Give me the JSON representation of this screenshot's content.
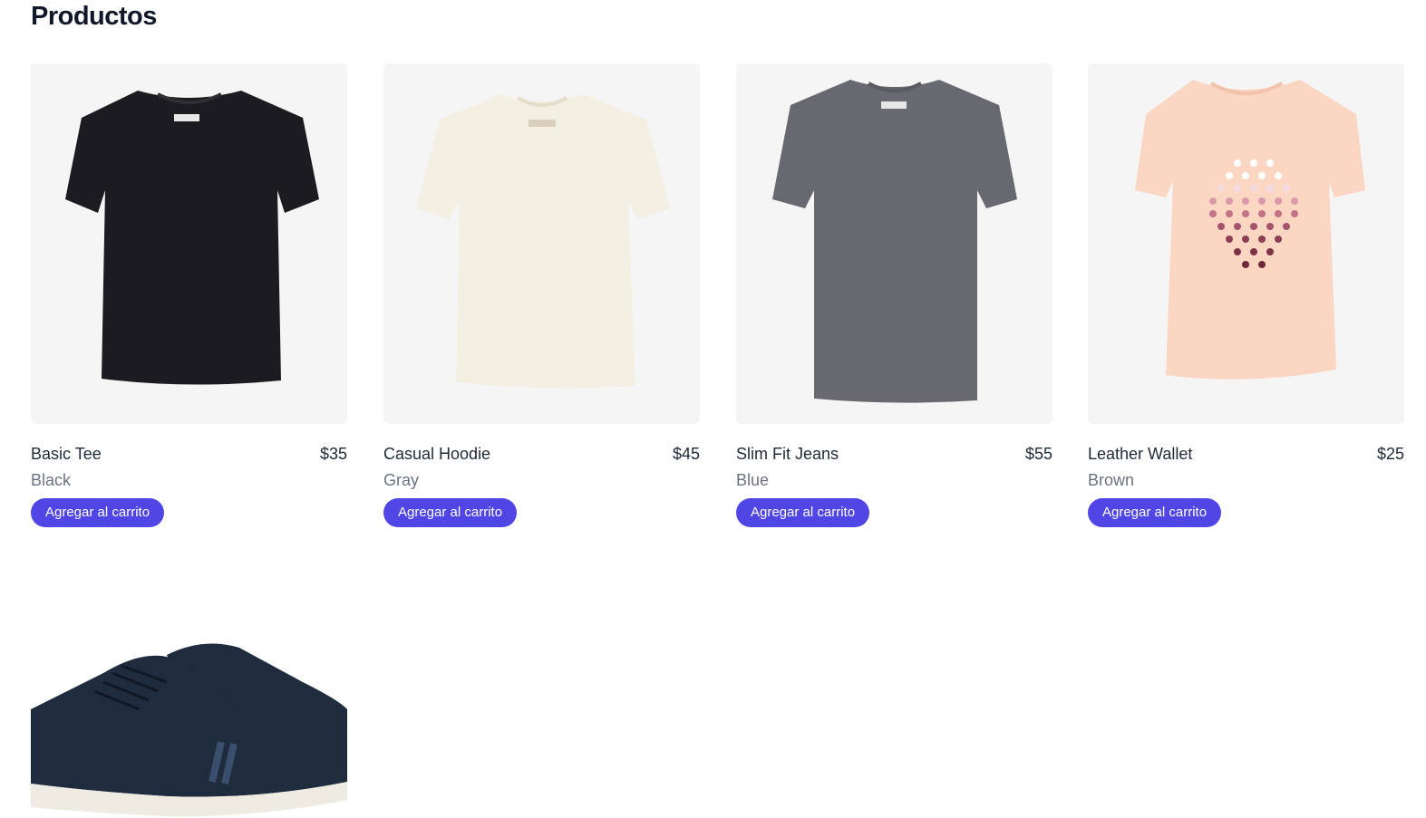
{
  "page": {
    "title": "Productos"
  },
  "colors": {
    "accent": "#4f46e5",
    "card_bg": "#f5f5f5"
  },
  "products": [
    {
      "name": "Basic Tee",
      "price": "$35",
      "color": "Black",
      "button": "Agregar al carrito",
      "image": "black-tshirt",
      "fill": "#1c1c20"
    },
    {
      "name": "Casual Hoodie",
      "price": "$45",
      "color": "Gray",
      "button": "Agregar al carrito",
      "image": "cream-tshirt",
      "fill": "#f3efe2"
    },
    {
      "name": "Slim Fit Jeans",
      "price": "$55",
      "color": "Blue",
      "button": "Agregar al carrito",
      "image": "gray-tshirt",
      "fill": "#686870"
    },
    {
      "name": "Leather Wallet",
      "price": "$25",
      "color": "Brown",
      "button": "Agregar al carrito",
      "image": "peach-tshirt-dots",
      "fill": "#fbd6c3"
    },
    {
      "image": "navy-sneakers",
      "fill": "#1e2c3d"
    }
  ]
}
